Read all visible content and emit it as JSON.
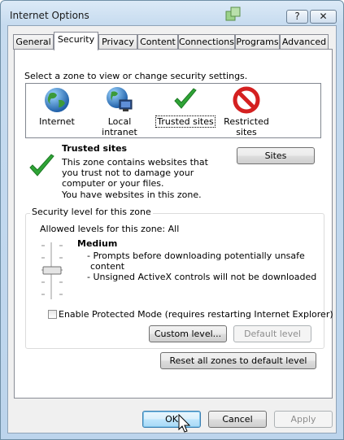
{
  "window": {
    "title": "Internet Options",
    "help_label": "?",
    "close_label": "✕"
  },
  "tabs": [
    "General",
    "Security",
    "Privacy",
    "Content",
    "Connections",
    "Programs",
    "Advanced"
  ],
  "security": {
    "prompt": "Select a zone to view or change security settings.",
    "zones": [
      {
        "label": "Internet",
        "icon": "globe-icon"
      },
      {
        "label": "Local intranet",
        "icon": "intranet-globe-icon"
      },
      {
        "label": "Trusted sites",
        "icon": "checkmark-icon",
        "selected": true
      },
      {
        "label": "Restricted sites",
        "icon": "restricted-icon"
      }
    ],
    "selected_zone": {
      "title": "Trusted sites",
      "description": "This zone contains websites that you trust not to damage your computer or your files.",
      "note": "You have websites in this zone.",
      "sites_button": "Sites"
    },
    "level_group": {
      "title": "Security level for this zone",
      "allowed": "Allowed levels for this zone: All",
      "level_name": "Medium",
      "bullets": [
        "- Prompts before downloading potentially unsafe",
        "content",
        "- Unsigned ActiveX controls will not be downloaded"
      ],
      "protected_mode": "Enable Protected Mode (requires restarting Internet Explorer)",
      "protected_mode_checked": false,
      "custom_level": "Custom level...",
      "default_level": "Default level"
    },
    "reset_all": "Reset all zones to default level"
  },
  "footer": {
    "ok": "OK",
    "cancel": "Cancel",
    "apply": "Apply"
  },
  "colors": {
    "check_green": "#2fa436",
    "restricted_red": "#d42020",
    "selection_blue": "#3c7fb1"
  }
}
